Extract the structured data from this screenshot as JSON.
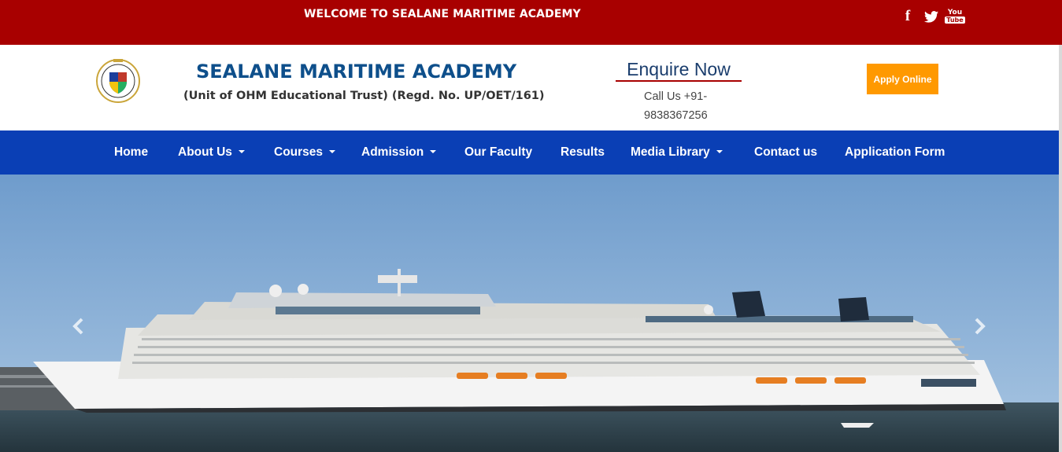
{
  "topbar": {
    "welcome": "WELCOME TO SEALANE MARITIME ACADEMY",
    "social": {
      "facebook": "f",
      "youtube_top": "You",
      "youtube_bottom": "Tube"
    },
    "background_color": "#a80000"
  },
  "header": {
    "title": "SEALANE MARITIME ACADEMY",
    "subtitle": "(Unit of OHM Educational Trust) (Regd. No. UP/OET/161)",
    "enquire": "Enquire Now",
    "call_line1": "Call Us +91-",
    "call_line2": "9838367256",
    "apply_button": "Apply Online",
    "apply_color": "#ff9900"
  },
  "nav": {
    "background_color": "#0a3fb5",
    "items": [
      {
        "label": "Home",
        "dropdown": false
      },
      {
        "label": "About Us",
        "dropdown": true
      },
      {
        "label": "Courses",
        "dropdown": true
      },
      {
        "label": "Admission",
        "dropdown": true
      },
      {
        "label": "Our Faculty",
        "dropdown": false
      },
      {
        "label": "Results",
        "dropdown": false
      },
      {
        "label": "Media Library",
        "dropdown": true
      },
      {
        "label": "Contact us",
        "dropdown": false
      },
      {
        "label": "Application Form",
        "dropdown": false
      }
    ]
  },
  "hero": {
    "icons": {
      "prev": "chevron-left-icon",
      "next": "chevron-right-icon"
    }
  }
}
